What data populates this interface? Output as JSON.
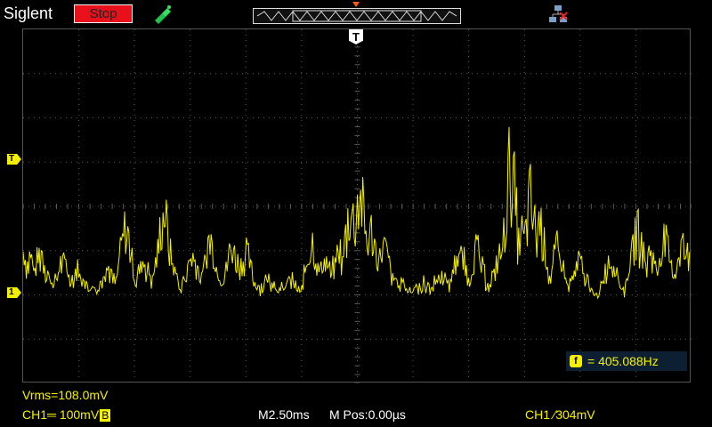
{
  "topbar": {
    "brand": "Siglent",
    "run_state": "Stop"
  },
  "screen": {
    "trigger_flag": "T",
    "ch1_marker": "1",
    "trigger_level_marker": "T"
  },
  "measure": {
    "f_icon": "f",
    "frequency": "= 405.088Hz"
  },
  "status": {
    "vrms": "Vrms=108.0mV",
    "ch1_scale": "CH1═ 100mV",
    "bw_badge": "B",
    "timebase": "M2.50ms",
    "mpos": "M Pos:0.00µs",
    "trigger": "CH1 ∕304mV"
  },
  "colors": {
    "ch1": "#f4f000",
    "stop": "#e8101a",
    "grid": "#5a5a5a",
    "freq_box": "#0d1f33"
  }
}
